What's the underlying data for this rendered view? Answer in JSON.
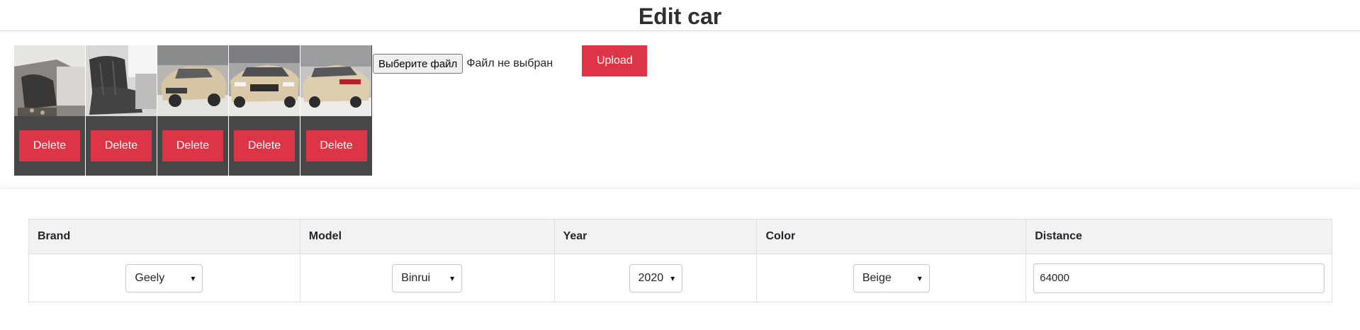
{
  "header": {
    "title": "Edit car"
  },
  "photos": [
    {
      "alt": "interior-front",
      "delete_label": "Delete"
    },
    {
      "alt": "interior-rear",
      "delete_label": "Delete"
    },
    {
      "alt": "exterior-front-left",
      "delete_label": "Delete"
    },
    {
      "alt": "exterior-front",
      "delete_label": "Delete"
    },
    {
      "alt": "exterior-rear",
      "delete_label": "Delete"
    }
  ],
  "upload": {
    "file_button_label": "Выберите файл",
    "file_status": "Файл не выбран",
    "upload_label": "Upload"
  },
  "table": {
    "headers": [
      "Brand",
      "Model",
      "Year",
      "Color",
      "Distance"
    ],
    "row": {
      "brand": "Geely",
      "model": "Binrui",
      "year": "2020",
      "color": "Beige",
      "distance": "64000"
    }
  },
  "colors": {
    "danger": "#dc3545",
    "tile_bg": "#474747",
    "header_bg": "#f2f2f2"
  },
  "icons": {
    "select_chevron": "chevron-down-icon"
  }
}
